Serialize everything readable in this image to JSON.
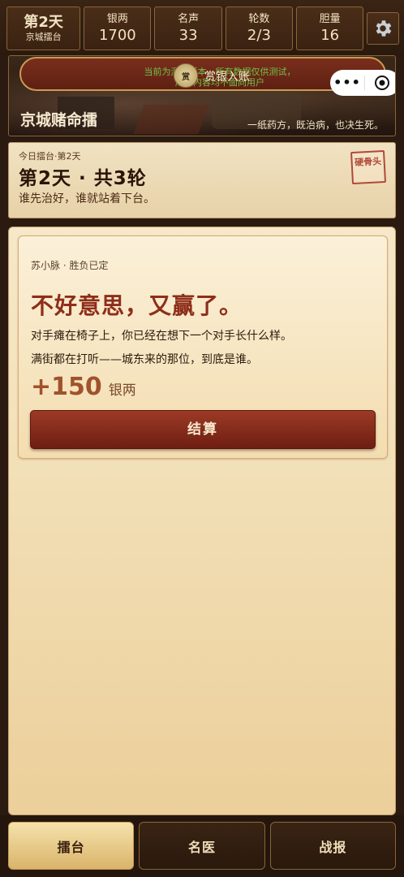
{
  "stats": {
    "day": {
      "value": "第2天",
      "sub": "京城擂台"
    },
    "items": [
      {
        "label": "银两",
        "value": "1700"
      },
      {
        "label": "名声",
        "value": "33"
      },
      {
        "label": "轮数",
        "value": "2/3"
      },
      {
        "label": "胆量",
        "value": "16"
      }
    ],
    "settings_icon": "gear-icon"
  },
  "banner": {
    "toast_line1": "当前为测试版本，所有数据仅供测试，",
    "toast_line2": "所有内容均不面向用户",
    "toast_title": "赏银入账",
    "coin_label": "赏",
    "menu_icon": "more-dots-icon",
    "close_icon": "target-icon",
    "title": "京城赌命擂",
    "subtitle": "一纸药方，既治病，也决生死。"
  },
  "today": {
    "small": "今日擂台·第2天",
    "title": "第2天 · 共3轮",
    "desc": "谁先治好，谁就站着下台。",
    "stamp": "硬骨头"
  },
  "result": {
    "who": "苏小脉 · 胜负已定",
    "headline": "不好意思，又赢了。",
    "line1": "对手瘫在椅子上，你已经在想下一个对手长什么样。",
    "line2": "满街都在打听——城东来的那位，到底是谁。",
    "amount": "+150",
    "unit": "银两",
    "button": "结算"
  },
  "nav": {
    "tabs": [
      "擂台",
      "名医",
      "战报"
    ],
    "active": "擂台"
  }
}
